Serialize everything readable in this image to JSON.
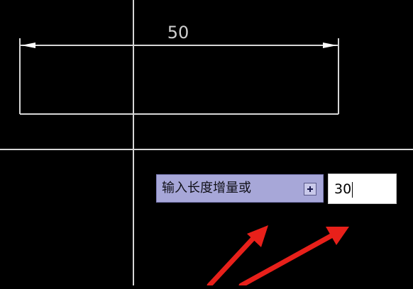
{
  "drawing": {
    "background_color": "#000000",
    "line_color": "#d6d6d6",
    "dimension": {
      "value": "50"
    }
  },
  "command_prompt": {
    "label": "输入长度增量或",
    "expand_icon": "plus-box-icon",
    "background_color": "#a7a7d8"
  },
  "dynamic_input": {
    "value": "30"
  },
  "annotations": {
    "arrow_color": "#e8201a",
    "arrow_count": 2
  }
}
